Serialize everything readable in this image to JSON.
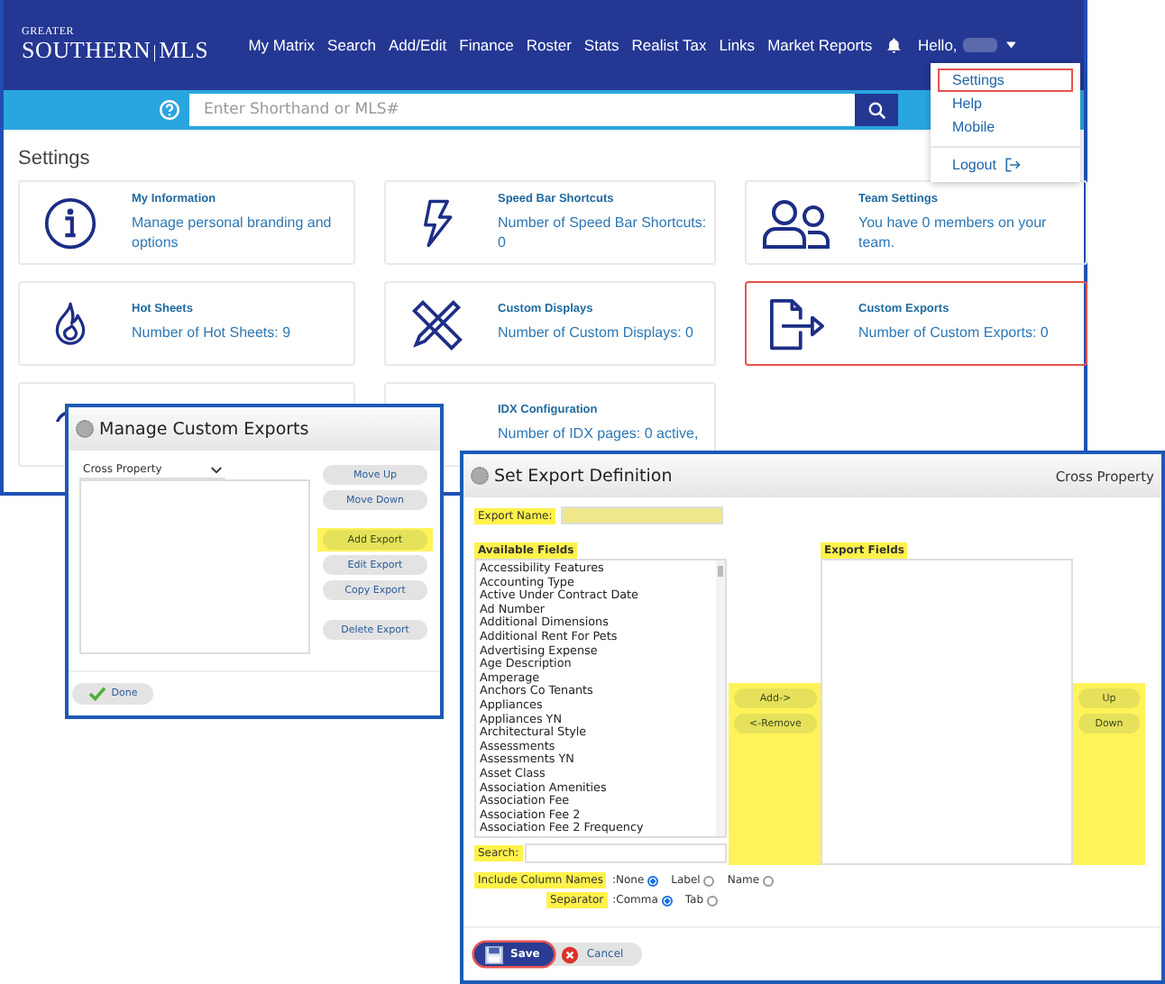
{
  "header": {
    "logo_top": "GREATER",
    "logo_main": "SOUTHERN",
    "logo_sep": "|",
    "logo_suffix": "MLS",
    "greeting": "Hello,",
    "nav": [
      "My Matrix",
      "Search",
      "Add/Edit",
      "Finance",
      "Roster",
      "Stats",
      "Realist Tax",
      "Links",
      "Market Reports"
    ]
  },
  "search": {
    "placeholder": "Enter Shorthand or MLS#"
  },
  "user_menu": [
    {
      "label": "Settings",
      "kind": "link",
      "outlined": true
    },
    {
      "label": "Help",
      "kind": "link",
      "outlined": false
    },
    {
      "label": "Mobile",
      "kind": "link",
      "outlined": false
    },
    {
      "label": "Logout",
      "kind": "logout",
      "outlined": false
    }
  ],
  "page_title": "Settings",
  "cards": [
    {
      "kind": "info",
      "title": "My Information",
      "text": "Manage personal branding and options",
      "outlined": false
    },
    {
      "kind": "bolt",
      "title": "Speed Bar Shortcuts",
      "text": "Number of Speed Bar Shortcuts: 0",
      "outlined": false
    },
    {
      "kind": "people",
      "title": "Team Settings",
      "text": "You have 0 members on your team.",
      "outlined": false
    },
    {
      "kind": "flame",
      "title": "Hot Sheets",
      "text": "Number of Hot Sheets: 9",
      "outlined": false
    },
    {
      "kind": "pencil",
      "title": "Custom Displays",
      "text": "Number of Custom Displays: 0",
      "outlined": false
    },
    {
      "kind": "export",
      "title": "Custom Exports",
      "text": "Number of Custom Exports: 0",
      "outlined": true
    },
    {
      "kind": "bell",
      "outlined": false
    },
    {
      "kind": "plain",
      "title": "IDX Configuration",
      "text": "Number of IDX pages: 0 active,",
      "outlined": false
    }
  ],
  "manage": {
    "title": "Manage Custom Exports",
    "class_select": "Cross Property",
    "button_groups": [
      [
        {
          "label": "Move Up",
          "highlighted": false
        },
        {
          "label": "Move Down",
          "highlighted": false
        }
      ],
      [
        {
          "label": "Add Export",
          "highlighted": true
        },
        {
          "label": "Edit Export",
          "highlighted": false
        },
        {
          "label": "Copy Export",
          "highlighted": false
        }
      ],
      [
        {
          "label": "Delete Export",
          "highlighted": false
        }
      ]
    ],
    "done": "Done"
  },
  "export": {
    "title": "Set Export Definition",
    "property_class": "Cross Property",
    "name_label": {
      "text": "Export Name:",
      "highlighted": true
    },
    "available_label": {
      "text": "Available Fields",
      "highlighted": true
    },
    "available_fields": [
      "Accessibility Features",
      "Accounting Type",
      "Active Under Contract Date",
      "Ad Number",
      "Additional Dimensions",
      "Additional Rent For Pets",
      "Advertising Expense",
      "Age Description",
      "Amperage",
      "Anchors Co Tenants",
      "Appliances",
      "Appliances YN",
      "Architectural Style",
      "Assessments",
      "Assessments YN",
      "Asset Class",
      "Association Amenities",
      "Association Fee",
      "Association Fee 2",
      "Association Fee 2 Frequency"
    ],
    "export_label": {
      "text": "Export Fields",
      "highlighted": true
    },
    "move_buttons": {
      "highlighted": true,
      "buttons": [
        "Add->",
        "<-Remove"
      ]
    },
    "order_buttons": {
      "highlighted": true,
      "buttons": [
        "Up",
        "Down"
      ]
    },
    "search_label": {
      "text": "Search:",
      "highlighted": true
    },
    "include_label": {
      "text": "Include Column Names",
      "highlighted": true
    },
    "include_options": [
      {
        "label": ":None",
        "selected": true
      },
      {
        "label": "Label",
        "selected": false
      },
      {
        "label": "Name",
        "selected": false
      }
    ],
    "separator_label": {
      "text": "Separator",
      "highlighted": true
    },
    "separator_options": [
      {
        "label": ":Comma",
        "selected": true
      },
      {
        "label": "Tab",
        "selected": false
      }
    ],
    "footer_buttons": [
      {
        "kind": "save",
        "label": "Save",
        "outlined": true
      },
      {
        "kind": "cancel",
        "label": "Cancel",
        "outlined": false
      }
    ]
  }
}
